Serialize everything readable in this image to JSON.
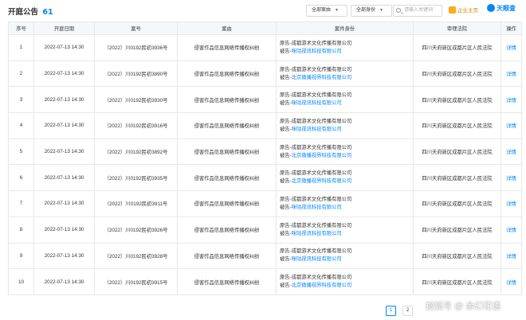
{
  "header": {
    "title": "开庭公告",
    "count": "61",
    "filter_reason": "全部案由",
    "filter_identity": "全部身份",
    "search_placeholder": "请输入关键词",
    "enterprise_badge": "企业主页",
    "logo": "天眼查"
  },
  "table": {
    "columns": [
      "序号",
      "开庭日期",
      "案号",
      "案由",
      "案件身份",
      "审理法院",
      "操作"
    ],
    "rows": [
      {
        "index": "1",
        "date": "2022-07-13 14:30",
        "case_no": "（2022）川0192民初3936号",
        "cause": "侵害作品信息网络传播权纠纷",
        "plaintiff_prefix": "原告-",
        "plaintiff": "成都游术文化传播有限公司",
        "defendant_prefix": "被告-",
        "defendant": "咪咕视讯科技有限公司",
        "court": "四川天府新区成都片区人民法院",
        "action": "详情"
      },
      {
        "index": "2",
        "date": "2022-07-13 14:30",
        "case_no": "（2022）川0192民初3890号",
        "cause": "侵害作品信息网络传播权纠纷",
        "plaintiff_prefix": "原告-",
        "plaintiff": "成都游术文化传播有限公司",
        "defendant_prefix": "被告-",
        "defendant": "北京微播视界科技有限公司",
        "court": "四川天府新区成都片区人民法院",
        "action": "详情"
      },
      {
        "index": "3",
        "date": "2022-07-13 14:30",
        "case_no": "（2022）川0192民初3930号",
        "cause": "侵害作品信息网络传播权纠纷",
        "plaintiff_prefix": "原告-",
        "plaintiff": "成都游术文化传播有限公司",
        "defendant_prefix": "被告-",
        "defendant": "咪咕视讯科技有限公司",
        "court": "四川天府新区成都片区人民法院",
        "action": "详情"
      },
      {
        "index": "4",
        "date": "2022-07-13 14:30",
        "case_no": "（2022）川0192民初3916号",
        "cause": "侵害作品信息网络传播权纠纷",
        "plaintiff_prefix": "原告-",
        "plaintiff": "成都游术文化传播有限公司",
        "defendant_prefix": "被告-",
        "defendant": "咪咕视讯科技有限公司",
        "court": "四川天府新区成都片区人民法院",
        "action": "详情"
      },
      {
        "index": "5",
        "date": "2022-07-13 14:30",
        "case_no": "（2022）川0192民初3892号",
        "cause": "侵害作品信息网络传播权纠纷",
        "plaintiff_prefix": "原告-",
        "plaintiff": "成都游术文化传播有限公司",
        "defendant_prefix": "被告-",
        "defendant": "北京微播视界科技有限公司",
        "court": "四川天府新区成都片区人民法院",
        "action": "详情"
      },
      {
        "index": "6",
        "date": "2022-07-13 14:30",
        "case_no": "（2022）川0192民初3935号",
        "cause": "侵害作品信息网络传播权纠纷",
        "plaintiff_prefix": "原告-",
        "plaintiff": "成都游术文化传播有限公司",
        "defendant_prefix": "被告-",
        "defendant": "北京微播视界科技有限公司",
        "court": "四川天府新区成都片区人民法院",
        "action": "详情"
      },
      {
        "index": "7",
        "date": "2022-07-13 14:30",
        "case_no": "（2022）川0192民初3911号",
        "cause": "侵害作品信息网络传播权纠纷",
        "plaintiff_prefix": "原告-",
        "plaintiff": "成都游术文化传播有限公司",
        "defendant_prefix": "被告-",
        "defendant": "咪咕视讯科技有限公司",
        "court": "四川天府新区成都片区人民法院",
        "action": "详情"
      },
      {
        "index": "8",
        "date": "2022-07-13 14:30",
        "case_no": "（2022）川0192民初3926号",
        "cause": "侵害作品信息网络传播权纠纷",
        "plaintiff_prefix": "原告-",
        "plaintiff": "成都游术文化传播有限公司",
        "defendant_prefix": "被告-",
        "defendant": "咪咕视讯科技有限公司",
        "court": "四川天府新区成都片区人民法院",
        "action": "详情"
      },
      {
        "index": "9",
        "date": "2022-07-13 14:30",
        "case_no": "（2022）川0192民初3928号",
        "cause": "侵害作品信息网络传播权纠纷",
        "plaintiff_prefix": "原告-",
        "plaintiff": "成都游术文化传播有限公司",
        "defendant_prefix": "被告-",
        "defendant": "咪咕视讯科技有限公司",
        "court": "四川天府新区成都片区人民法院",
        "action": "详情"
      },
      {
        "index": "10",
        "date": "2022-07-13 14:30",
        "case_no": "（2022）川0192民初3915号",
        "cause": "侵害作品信息网络传播权纠纷",
        "plaintiff_prefix": "原告-",
        "plaintiff": "成都游术文化传播有限公司",
        "defendant_prefix": "被告-",
        "defendant": "北京微播视界科技有限公司",
        "court": "四川天府新区成都片区人民法院",
        "action": "详情"
      }
    ]
  },
  "pagination": {
    "pages": [
      "1",
      "2"
    ]
  },
  "watermark": "搜狐号 @ 余幻花语",
  "colors": {
    "accent": "#0084ff",
    "header_bg": "#f5f8fb",
    "border": "#e8e8e8",
    "badge": "#faad14"
  },
  "icons": {
    "search": "search-icon",
    "caret": "chevron-down-icon",
    "crown": "crown-icon",
    "logo": "tianyancha-logo-icon"
  }
}
